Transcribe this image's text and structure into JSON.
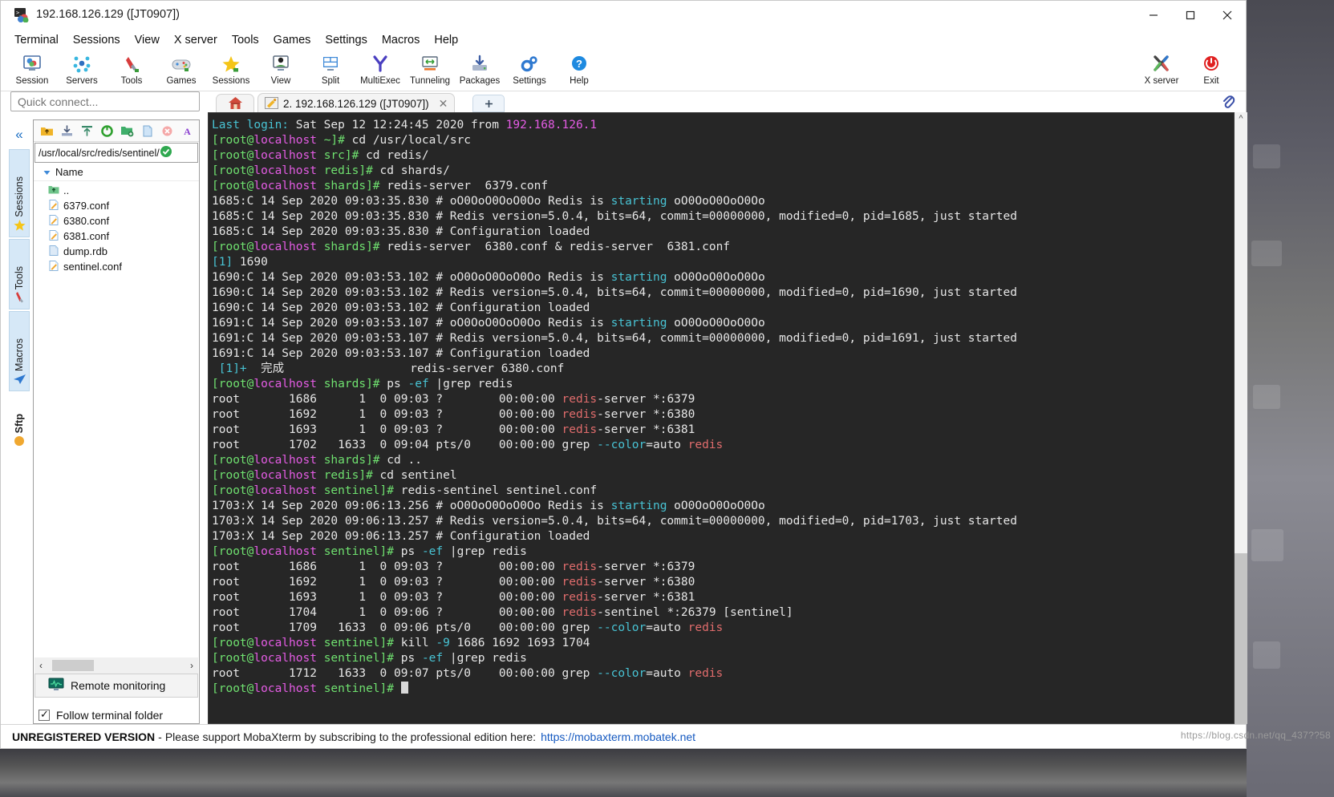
{
  "window": {
    "title": "192.168.126.129 ([JT0907])",
    "icon": "mobaxterm-icon",
    "minimize": "—",
    "maximize": "☐",
    "close": "✕"
  },
  "menubar": {
    "items": [
      "Terminal",
      "Sessions",
      "View",
      "X server",
      "Tools",
      "Games",
      "Settings",
      "Macros",
      "Help"
    ]
  },
  "toolbar": {
    "buttons": [
      {
        "label": "Session",
        "icon": "session-icon"
      },
      {
        "label": "Servers",
        "icon": "servers-icon"
      },
      {
        "label": "Tools",
        "icon": "tools-icon"
      },
      {
        "label": "Games",
        "icon": "games-icon"
      },
      {
        "label": "Sessions",
        "icon": "sessions-star-icon"
      },
      {
        "label": "View",
        "icon": "view-icon"
      },
      {
        "label": "Split",
        "icon": "split-icon"
      },
      {
        "label": "MultiExec",
        "icon": "multiexec-icon"
      },
      {
        "label": "Tunneling",
        "icon": "tunneling-icon"
      },
      {
        "label": "Packages",
        "icon": "packages-icon"
      },
      {
        "label": "Settings",
        "icon": "settings-gear-icon"
      },
      {
        "label": "Help",
        "icon": "help-icon"
      }
    ],
    "right_buttons": [
      {
        "label": "X server",
        "icon": "x-server-icon"
      },
      {
        "label": "Exit",
        "icon": "exit-power-icon"
      }
    ]
  },
  "quick_connect": {
    "placeholder": "Quick connect..."
  },
  "ribbon": {
    "collapse_icon": "double-chevron-left-icon",
    "tabs": [
      {
        "label": "Sessions",
        "icon": "star-icon"
      },
      {
        "label": "Tools",
        "icon": "swiss-knife-icon"
      },
      {
        "label": "Macros",
        "icon": "paper-plane-icon"
      },
      {
        "label": "Sftp",
        "icon": "sftp-icon"
      }
    ]
  },
  "file_browser": {
    "toolbar_icons": [
      "folder-up-icon",
      "download-icon",
      "upload-icon",
      "refresh-icon",
      "new-folder-icon",
      "new-file-icon",
      "delete-icon",
      "text-mode-icon"
    ],
    "path": "/usr/local/src/redis/sentinel/",
    "path_ok_icon": "check-circle-icon",
    "column_header": "Name",
    "sort_icon": "caret-down-icon",
    "files": [
      {
        "name": "..",
        "icon": "parent-folder-icon"
      },
      {
        "name": "6379.conf",
        "icon": "conf-file-icon"
      },
      {
        "name": "6380.conf",
        "icon": "conf-file-icon"
      },
      {
        "name": "6381.conf",
        "icon": "conf-file-icon"
      },
      {
        "name": "dump.rdb",
        "icon": "file-icon"
      },
      {
        "name": "sentinel.conf",
        "icon": "conf-file-icon"
      }
    ],
    "remote_monitoring": "Remote monitoring",
    "remote_monitoring_icon": "monitor-graph-icon",
    "follow_terminal_folder": "Follow terminal folder",
    "follow_checked": true,
    "scroll_left": "‹",
    "scroll_right": "›"
  },
  "tabs": {
    "home_icon": "home-icon",
    "active": {
      "label": "2. 192.168.126.129 ([JT0907])",
      "icon": "ssh-key-icon",
      "close": "✕"
    },
    "new_tab_icon": "plus-icon",
    "clip_icon": "paperclip-icon"
  },
  "terminal": {
    "scroll_up_icon": "chevron-up-icon",
    "cursor": "block-cursor",
    "lines": [
      [
        {
          "t": "Last login:",
          "c": "cy"
        },
        {
          "t": " Sat Sep 12 12:24:45 2020 from ",
          "c": "wh"
        },
        {
          "t": "192.168.126.1",
          "c": "mg"
        }
      ],
      [
        {
          "t": "[root@",
          "c": "gr"
        },
        {
          "t": "localhost",
          "c": "mg"
        },
        {
          "t": " ~]# ",
          "c": "gr"
        },
        {
          "t": "cd /usr/local/src",
          "c": "wh"
        }
      ],
      [
        {
          "t": "[root@",
          "c": "gr"
        },
        {
          "t": "localhost",
          "c": "mg"
        },
        {
          "t": " src]# ",
          "c": "gr"
        },
        {
          "t": "cd redis/",
          "c": "wh"
        }
      ],
      [
        {
          "t": "[root@",
          "c": "gr"
        },
        {
          "t": "localhost",
          "c": "mg"
        },
        {
          "t": " redis]# ",
          "c": "gr"
        },
        {
          "t": "cd shards/",
          "c": "wh"
        }
      ],
      [
        {
          "t": "[root@",
          "c": "gr"
        },
        {
          "t": "localhost",
          "c": "mg"
        },
        {
          "t": " shards]# ",
          "c": "gr"
        },
        {
          "t": "redis-server  6379.conf",
          "c": "wh"
        }
      ],
      [
        {
          "t": "1685:C 14 Sep 2020 09:03:35.830 # oO0OoO0OoO0Oo Redis is ",
          "c": "wh"
        },
        {
          "t": "starting",
          "c": "cy"
        },
        {
          "t": " oO0OoO0OoO0Oo",
          "c": "wh"
        }
      ],
      [
        {
          "t": "1685:C 14 Sep 2020 09:03:35.830 # Redis version=5.0.4, bits=64, commit=00000000, modified=0, pid=1685, just started",
          "c": "wh"
        }
      ],
      [
        {
          "t": "1685:C 14 Sep 2020 09:03:35.830 # Configuration loaded",
          "c": "wh"
        }
      ],
      [
        {
          "t": "[root@",
          "c": "gr"
        },
        {
          "t": "localhost",
          "c": "mg"
        },
        {
          "t": " shards]# ",
          "c": "gr"
        },
        {
          "t": "redis-server  6380.conf & redis-server  6381.conf",
          "c": "wh"
        }
      ],
      [
        {
          "t": "[1]",
          "c": "cy"
        },
        {
          "t": " 1690",
          "c": "wh"
        }
      ],
      [
        {
          "t": "1690:C 14 Sep 2020 09:03:53.102 # oO0OoO0OoO0Oo Redis is ",
          "c": "wh"
        },
        {
          "t": "starting",
          "c": "cy"
        },
        {
          "t": " oO0OoO0OoO0Oo",
          "c": "wh"
        }
      ],
      [
        {
          "t": "1690:C 14 Sep 2020 09:03:53.102 # Redis version=5.0.4, bits=64, commit=00000000, modified=0, pid=1690, just started",
          "c": "wh"
        }
      ],
      [
        {
          "t": "1690:C 14 Sep 2020 09:03:53.102 # Configuration loaded",
          "c": "wh"
        }
      ],
      [
        {
          "t": "1691:C 14 Sep 2020 09:03:53.107 # oO0OoO0OoO0Oo Redis is ",
          "c": "wh"
        },
        {
          "t": "starting",
          "c": "cy"
        },
        {
          "t": " oO0OoO0OoO0Oo",
          "c": "wh"
        }
      ],
      [
        {
          "t": "1691:C 14 Sep 2020 09:03:53.107 # Redis version=5.0.4, bits=64, commit=00000000, modified=0, pid=1691, just started",
          "c": "wh"
        }
      ],
      [
        {
          "t": "1691:C 14 Sep 2020 09:03:53.107 # Configuration loaded",
          "c": "wh"
        }
      ],
      [
        {
          "t": " [1]+",
          "c": "cy"
        },
        {
          "t": "  完成                  redis-server 6380.conf",
          "c": "wh"
        }
      ],
      [
        {
          "t": "[root@",
          "c": "gr"
        },
        {
          "t": "localhost",
          "c": "mg"
        },
        {
          "t": " shards]# ",
          "c": "gr"
        },
        {
          "t": "ps ",
          "c": "wh"
        },
        {
          "t": "-ef",
          "c": "cy"
        },
        {
          "t": " |grep redis",
          "c": "wh"
        }
      ],
      [
        {
          "t": "root       1686      1  0 09:03 ?        00:00:00 ",
          "c": "wh"
        },
        {
          "t": "redis",
          "c": "rd"
        },
        {
          "t": "-server *:6379",
          "c": "wh"
        }
      ],
      [
        {
          "t": "root       1692      1  0 09:03 ?        00:00:00 ",
          "c": "wh"
        },
        {
          "t": "redis",
          "c": "rd"
        },
        {
          "t": "-server *:6380",
          "c": "wh"
        }
      ],
      [
        {
          "t": "root       1693      1  0 09:03 ?        00:00:00 ",
          "c": "wh"
        },
        {
          "t": "redis",
          "c": "rd"
        },
        {
          "t": "-server *:6381",
          "c": "wh"
        }
      ],
      [
        {
          "t": "root       1702   1633  0 09:04 pts/0    00:00:00 grep ",
          "c": "wh"
        },
        {
          "t": "--color",
          "c": "cy"
        },
        {
          "t": "=auto ",
          "c": "wh"
        },
        {
          "t": "redis",
          "c": "rd"
        }
      ],
      [
        {
          "t": "[root@",
          "c": "gr"
        },
        {
          "t": "localhost",
          "c": "mg"
        },
        {
          "t": " shards]# ",
          "c": "gr"
        },
        {
          "t": "cd ..",
          "c": "wh"
        }
      ],
      [
        {
          "t": "[root@",
          "c": "gr"
        },
        {
          "t": "localhost",
          "c": "mg"
        },
        {
          "t": " redis]# ",
          "c": "gr"
        },
        {
          "t": "cd sentinel",
          "c": "wh"
        }
      ],
      [
        {
          "t": "[root@",
          "c": "gr"
        },
        {
          "t": "localhost",
          "c": "mg"
        },
        {
          "t": " sentinel]# ",
          "c": "gr"
        },
        {
          "t": "redis-sentinel sentinel.conf",
          "c": "wh"
        }
      ],
      [
        {
          "t": "1703:X 14 Sep 2020 09:06:13.256 # oO0OoO0OoO0Oo Redis is ",
          "c": "wh"
        },
        {
          "t": "starting",
          "c": "cy"
        },
        {
          "t": " oO0OoO0OoO0Oo",
          "c": "wh"
        }
      ],
      [
        {
          "t": "1703:X 14 Sep 2020 09:06:13.257 # Redis version=5.0.4, bits=64, commit=00000000, modified=0, pid=1703, just started",
          "c": "wh"
        }
      ],
      [
        {
          "t": "1703:X 14 Sep 2020 09:06:13.257 # Configuration loaded",
          "c": "wh"
        }
      ],
      [
        {
          "t": "[root@",
          "c": "gr"
        },
        {
          "t": "localhost",
          "c": "mg"
        },
        {
          "t": " sentinel]# ",
          "c": "gr"
        },
        {
          "t": "ps ",
          "c": "wh"
        },
        {
          "t": "-ef",
          "c": "cy"
        },
        {
          "t": " |grep redis",
          "c": "wh"
        }
      ],
      [
        {
          "t": "root       1686      1  0 09:03 ?        00:00:00 ",
          "c": "wh"
        },
        {
          "t": "redis",
          "c": "rd"
        },
        {
          "t": "-server *:6379",
          "c": "wh"
        }
      ],
      [
        {
          "t": "root       1692      1  0 09:03 ?        00:00:00 ",
          "c": "wh"
        },
        {
          "t": "redis",
          "c": "rd"
        },
        {
          "t": "-server *:6380",
          "c": "wh"
        }
      ],
      [
        {
          "t": "root       1693      1  0 09:03 ?        00:00:00 ",
          "c": "wh"
        },
        {
          "t": "redis",
          "c": "rd"
        },
        {
          "t": "-server *:6381",
          "c": "wh"
        }
      ],
      [
        {
          "t": "root       1704      1  0 09:06 ?        00:00:00 ",
          "c": "wh"
        },
        {
          "t": "redis",
          "c": "rd"
        },
        {
          "t": "-sentinel *:26379 [sentinel]",
          "c": "wh"
        }
      ],
      [
        {
          "t": "root       1709   1633  0 09:06 pts/0    00:00:00 grep ",
          "c": "wh"
        },
        {
          "t": "--color",
          "c": "cy"
        },
        {
          "t": "=auto ",
          "c": "wh"
        },
        {
          "t": "redis",
          "c": "rd"
        }
      ],
      [
        {
          "t": "[root@",
          "c": "gr"
        },
        {
          "t": "localhost",
          "c": "mg"
        },
        {
          "t": " sentinel]# ",
          "c": "gr"
        },
        {
          "t": "kill ",
          "c": "wh"
        },
        {
          "t": "-9",
          "c": "cy"
        },
        {
          "t": " 1686 1692 1693 1704",
          "c": "wh"
        }
      ],
      [
        {
          "t": "[root@",
          "c": "gr"
        },
        {
          "t": "localhost",
          "c": "mg"
        },
        {
          "t": " sentinel]# ",
          "c": "gr"
        },
        {
          "t": "ps ",
          "c": "wh"
        },
        {
          "t": "-ef",
          "c": "cy"
        },
        {
          "t": " |grep redis",
          "c": "wh"
        }
      ],
      [
        {
          "t": "root       1712   1633  0 09:07 pts/0    00:00:00 grep ",
          "c": "wh"
        },
        {
          "t": "--color",
          "c": "cy"
        },
        {
          "t": "=auto ",
          "c": "wh"
        },
        {
          "t": "redis",
          "c": "rd"
        }
      ],
      [
        {
          "t": "[root@",
          "c": "gr"
        },
        {
          "t": "localhost",
          "c": "mg"
        },
        {
          "t": " sentinel]# ",
          "c": "gr"
        },
        {
          "t": "",
          "c": "cursor"
        }
      ]
    ]
  },
  "statusbar": {
    "badge": "UNREGISTERED VERSION",
    "dash": "-",
    "text": "Please support MobaXterm by subscribing to the professional edition here:",
    "link": "https://mobaxterm.mobatek.net"
  },
  "watermark": "https://blog.csdn.net/qq_437??58",
  "colors": {
    "terminal_bg": "#262626",
    "accent_blue": "#1b6fc4",
    "link_blue": "#1559c0",
    "prompt_green": "#6fe06f",
    "host_magenta": "#e45ce4",
    "grep_red": "#e06c6c",
    "cyan": "#48c3d4"
  }
}
